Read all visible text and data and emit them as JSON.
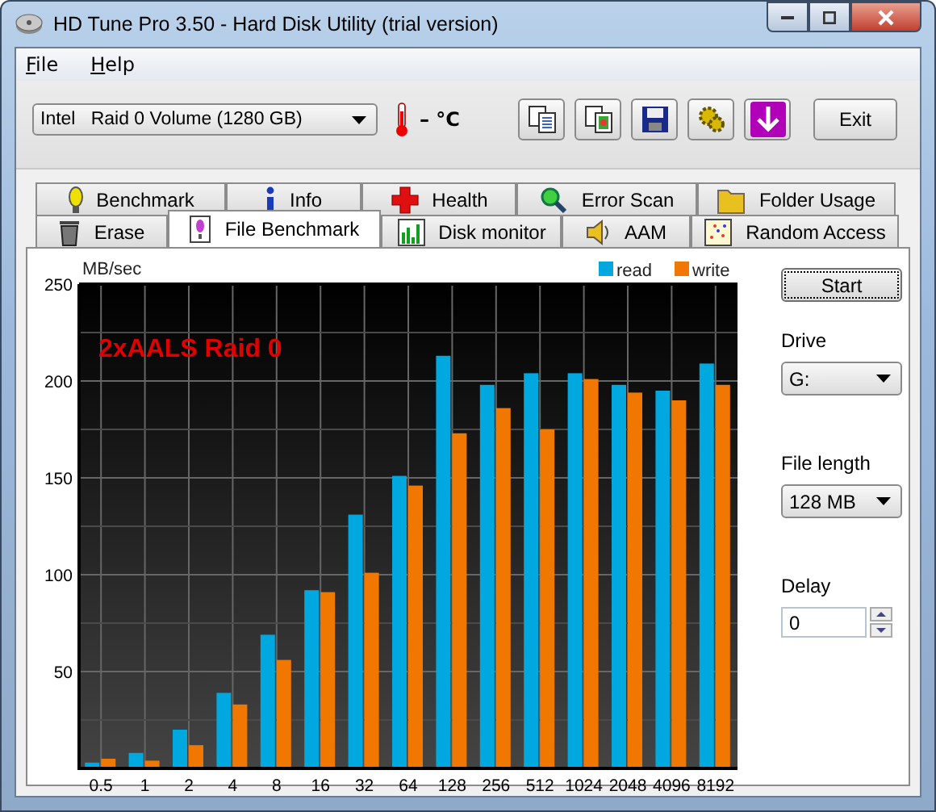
{
  "window": {
    "title": "HD Tune Pro 3.50 - Hard Disk Utility (trial version)"
  },
  "menu": [
    {
      "label": "File"
    },
    {
      "label": "Help"
    }
  ],
  "toolbar": {
    "drive": "Intel   Raid 0 Volume (1280 GB)",
    "temperature": "– °C",
    "exit": "Exit"
  },
  "tab_rows": [
    {
      "tabs": [
        {
          "label": "Benchmark",
          "selected": false
        },
        {
          "label": "Info",
          "selected": false
        },
        {
          "label": "Health",
          "selected": false
        },
        {
          "label": "Error Scan",
          "selected": false
        },
        {
          "label": "Folder Usage",
          "selected": false
        }
      ]
    },
    {
      "tabs": [
        {
          "label": "Erase",
          "selected": false
        },
        {
          "label": "File Benchmark",
          "selected": true
        },
        {
          "label": "Disk monitor",
          "selected": false
        },
        {
          "label": "AAM",
          "selected": false
        },
        {
          "label": "Random Access",
          "selected": false
        }
      ]
    }
  ],
  "chart_data": {
    "type": "bar",
    "ylabel": "MB/sec",
    "categories": [
      "0.5",
      "1",
      "2",
      "4",
      "8",
      "16",
      "32",
      "64",
      "128",
      "256",
      "512",
      "1024",
      "2048",
      "4096",
      "8192"
    ],
    "series": [
      {
        "name": "read",
        "color": "#00a8e0",
        "values": [
          3,
          8,
          20,
          39,
          69,
          92,
          131,
          151,
          213,
          198,
          204,
          204,
          198,
          195,
          209
        ]
      },
      {
        "name": "write",
        "color": "#f07800",
        "values": [
          5,
          4,
          12,
          33,
          56,
          91,
          101,
          146,
          173,
          186,
          175,
          201,
          194,
          190,
          198
        ]
      }
    ],
    "ylim": [
      0,
      250
    ],
    "yticks": [
      50,
      100,
      150,
      200,
      250
    ],
    "annotations": [
      {
        "text": "2xAALS Raid 0"
      }
    ],
    "grid": true,
    "legend": true
  },
  "controls": {
    "start": "Start",
    "drive_label": "Drive",
    "drive": "G:",
    "file_length_label": "File length",
    "file_length": "128 MB",
    "delay_label": "Delay",
    "delay": "0"
  }
}
